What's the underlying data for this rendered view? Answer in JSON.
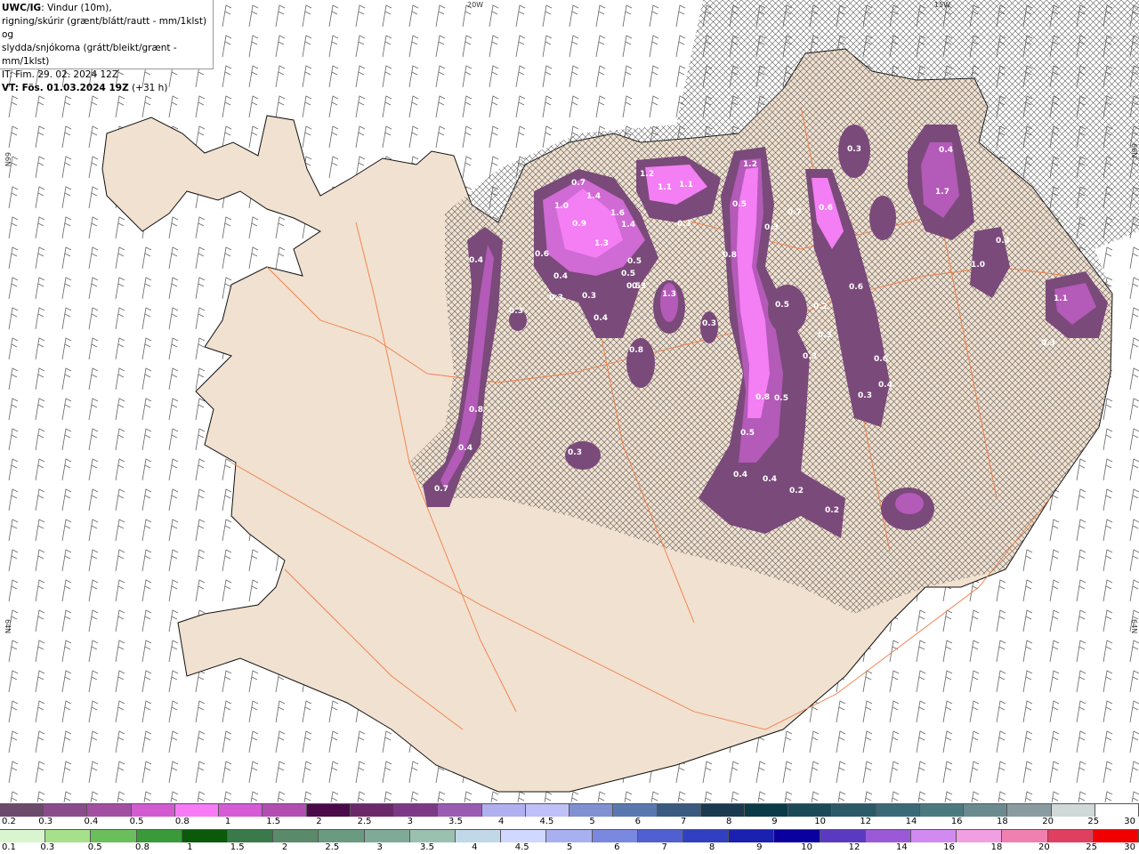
{
  "header": {
    "model": "UWC/IG",
    "desc1": ": Vindur (10m),",
    "desc2": "rigning/skúrir (grænt/blátt/rautt - mm/1klst) og",
    "desc3": "slydda/snjókoma (grátt/bleikt/grænt - mm/1klst)",
    "issue": "IT: Fim. 29. 02. 2024 12Z",
    "valid_label": "VT: Fös. 01.03.2024 19Z",
    "lead": "(+31 h)"
  },
  "graticule": {
    "lon_20w": "20W",
    "lon_15w": "15W",
    "lat_66n_left": "66N",
    "lat_66n_right": "66N",
    "lat_64n_left": "64N",
    "lat_64n_right": "64N"
  },
  "precip_labels": [
    "0.7",
    "1.4",
    "1.0",
    "1.6",
    "1.4",
    "0.9",
    "1.3",
    "0.6",
    "0.4",
    "0.5",
    "0.5",
    "0.3",
    "0.4",
    "0.3",
    "1.2",
    "1.1",
    "1.1",
    "0.3",
    "1.2",
    "0.5",
    "0.3",
    "0.7",
    "0.6",
    "0.8",
    "0.3",
    "0.5",
    "0.2",
    "0.3",
    "0.3",
    "0.6",
    "0.4",
    "0.3",
    "0.8",
    "0.5",
    "0.5",
    "0.4",
    "0.4",
    "0.2",
    "0.2",
    "1.7",
    "0.4",
    "1.0",
    "0.4",
    "1.1",
    "0.3",
    "0.3",
    "0.4",
    "0.8",
    "0.4",
    "0.7",
    "0.3",
    "1.3",
    "0.3",
    "0.8",
    "0.6",
    "0.5",
    "0.3"
  ],
  "legend": {
    "top_ticks": [
      "0.2",
      "0.3",
      "0.4",
      "0.5",
      "0.8",
      "1",
      "1.5",
      "2",
      "2.5",
      "3",
      "3.5",
      "4",
      "4.5",
      "5",
      "6",
      "7",
      "8",
      "9",
      "10",
      "12",
      "14",
      "16",
      "18",
      "20",
      "25",
      "30"
    ],
    "bottom_ticks": [
      "0.1",
      "0.3",
      "0.5",
      "0.8",
      "1",
      "1.5",
      "2",
      "2.5",
      "3",
      "3.5",
      "4",
      "4.5",
      "5",
      "6",
      "7",
      "8",
      "9",
      "10",
      "12",
      "14",
      "16",
      "18",
      "20",
      "25",
      "30"
    ],
    "top_colors": [
      "#6b4a6b",
      "#8a4c8a",
      "#a24fa2",
      "#d25bd2",
      "#f77af7",
      "#d65bd6",
      "#b24db2",
      "#4a0a4a",
      "#6a2a6a",
      "#7c3a86",
      "#9a5cb2",
      "#b0b0f0",
      "#c0c0f8",
      "#8090d0",
      "#5a78b0",
      "#3a5a80",
      "#1a3a50",
      "#0a3a48",
      "#1a4a58",
      "#2a5a68",
      "#3a6a78",
      "#4a7a80",
      "#6a8a90",
      "#8a9ca0",
      "#d0d8d8",
      "#ffffff"
    ],
    "bottom_colors": [
      "#d8f5d0",
      "#a6e08a",
      "#6abf5a",
      "#3a9a3a",
      "#0a5a0a",
      "#3a7a4a",
      "#5a8a6a",
      "#6a9a80",
      "#80aa98",
      "#9ac0b0",
      "#c0d8e8",
      "#d0d8ff",
      "#a8b0f0",
      "#7a88e0",
      "#5060d0",
      "#3040c0",
      "#1a20b0",
      "#0a00a0",
      "#5a3ac0",
      "#9a5ad8",
      "#d08af0",
      "#f0a0e0",
      "#f080b0",
      "#e04060",
      "#f00000"
    ]
  },
  "colors": {
    "land": "#f1e1d0",
    "road": "#ef7d47",
    "coast": "#111111",
    "precip_light": "#7a4a7a",
    "precip_mid": "#a04ea8",
    "precip_pink": "#f47ef4"
  }
}
